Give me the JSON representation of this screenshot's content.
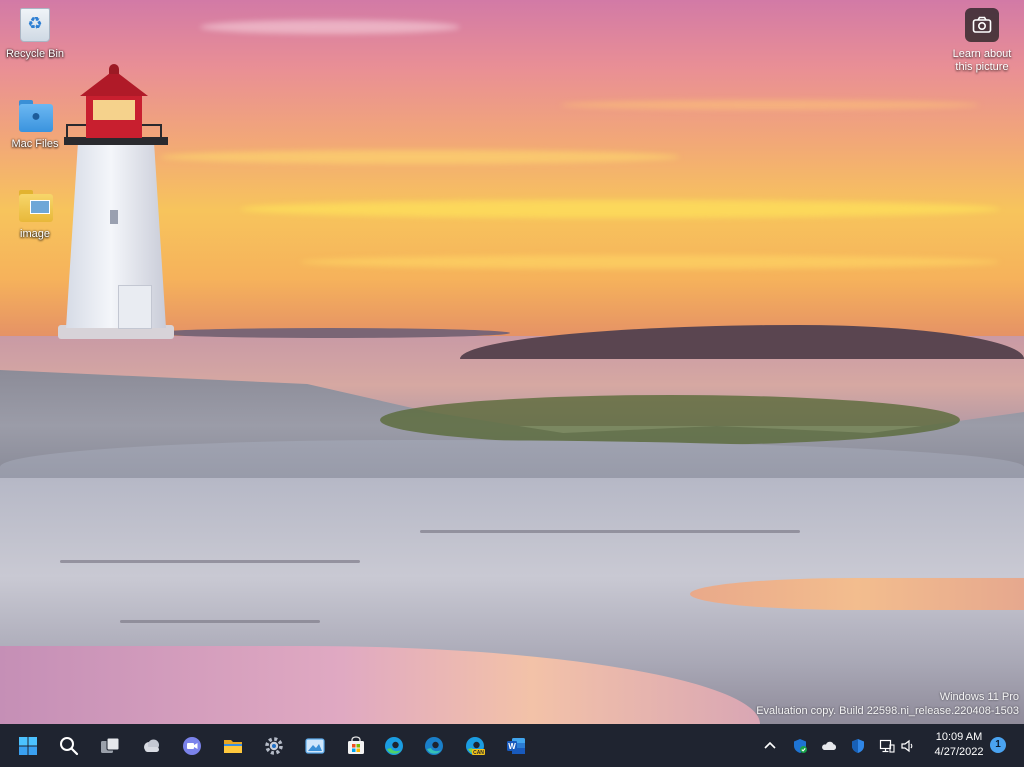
{
  "desktop": {
    "icons": [
      {
        "label": "Recycle Bin",
        "icon": "recycle-bin-icon"
      },
      {
        "label": "Mac Files",
        "icon": "folder-icon"
      },
      {
        "label": "image",
        "icon": "folder-image-icon"
      }
    ],
    "learn_about_picture": {
      "label_line1": "Learn about",
      "label_line2": "this picture",
      "icon": "camera-icon"
    },
    "watermark": {
      "line1": "Windows 11 Pro",
      "line2": "Evaluation copy. Build 22598.ni_release.220408-1503"
    }
  },
  "taskbar": {
    "apps": [
      {
        "name": "start",
        "icon": "windows-start-icon"
      },
      {
        "name": "search",
        "icon": "search-icon"
      },
      {
        "name": "task-view",
        "icon": "task-view-icon"
      },
      {
        "name": "widgets",
        "icon": "widgets-weather-icon"
      },
      {
        "name": "teams-chat",
        "icon": "teams-chat-icon"
      },
      {
        "name": "file-explorer",
        "icon": "file-explorer-icon"
      },
      {
        "name": "settings",
        "icon": "settings-gear-icon"
      },
      {
        "name": "photos",
        "icon": "photos-icon"
      },
      {
        "name": "microsoft-store",
        "icon": "store-icon"
      },
      {
        "name": "edge",
        "icon": "edge-icon"
      },
      {
        "name": "edge-beta",
        "icon": "edge-beta-icon"
      },
      {
        "name": "edge-canary",
        "icon": "edge-canary-icon",
        "badge": "CAN"
      },
      {
        "name": "word",
        "icon": "word-icon",
        "letter": "W"
      }
    ],
    "tray": {
      "icons": [
        "chevron-up-icon",
        "defender-icon",
        "onedrive-icon",
        "security-shield-icon",
        "network-icon",
        "volume-icon"
      ],
      "time": "10:09 AM",
      "date": "4/27/2022",
      "notification_count": "1"
    }
  },
  "colors": {
    "taskbar_bg": "#1f2430",
    "accent": "#2d7fd3"
  }
}
